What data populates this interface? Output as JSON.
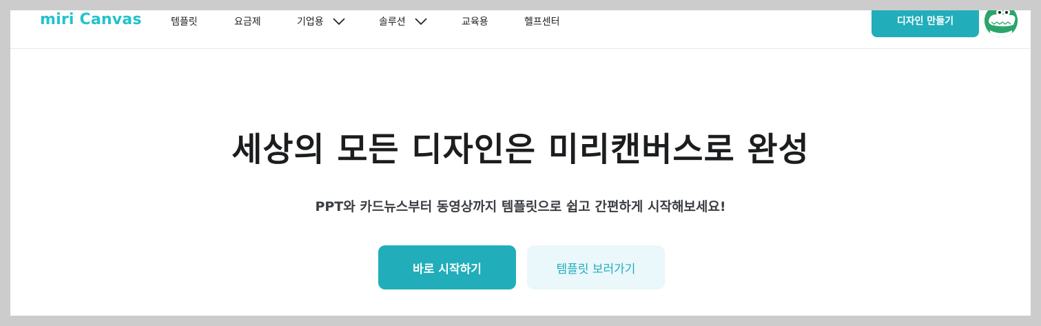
{
  "header": {
    "logo_text": "miri Canvas",
    "nav": [
      {
        "label": "템플릿"
      },
      {
        "label": "요금제"
      },
      {
        "label": "기업용",
        "has_dropdown": true
      },
      {
        "label": "솔루션",
        "has_dropdown": true
      },
      {
        "label": "교육용"
      },
      {
        "label": "헬프센터"
      }
    ],
    "cta_label": "디자인 만들기",
    "avatar_icon": "crocodile-avatar-icon"
  },
  "hero": {
    "title": "세상의 모든 디자인은 미리캔버스로 완성",
    "subtitle": "PPT와 카드뉴스부터 동영상까지 템플릿으로 쉽고 간편하게 시작해보세요!",
    "primary_button": "바로 시작하기",
    "secondary_button": "템플릿 보러가기"
  },
  "colors": {
    "accent": "#21aeba",
    "logo": "#22c3cb",
    "secondary_bg": "#eaf7fb",
    "frame": "#cccccc",
    "avatar_bg": "#2aa56c"
  }
}
